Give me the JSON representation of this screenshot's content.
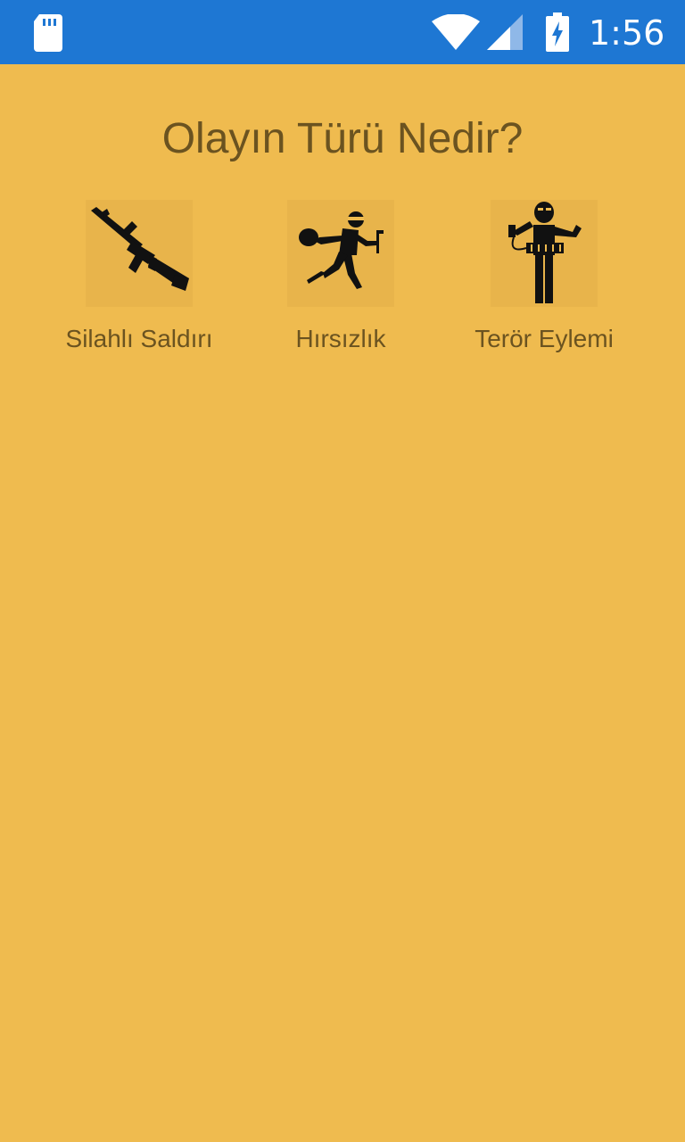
{
  "status_bar": {
    "time": "1:56",
    "icons": [
      "sd-card-icon",
      "wifi-icon",
      "cell-signal-icon",
      "battery-charging-icon"
    ],
    "background_color": "#1E77D3"
  },
  "screen": {
    "title": "Olayın Türü Nedir?",
    "background_color": "#EFBB4F",
    "text_color": "#6B5320"
  },
  "options": [
    {
      "label": "Silahlı Saldırı",
      "icon": "rifle-icon"
    },
    {
      "label": "Hırsızlık",
      "icon": "thief-icon"
    },
    {
      "label": "Terör Eylemi",
      "icon": "bomber-icon"
    }
  ]
}
